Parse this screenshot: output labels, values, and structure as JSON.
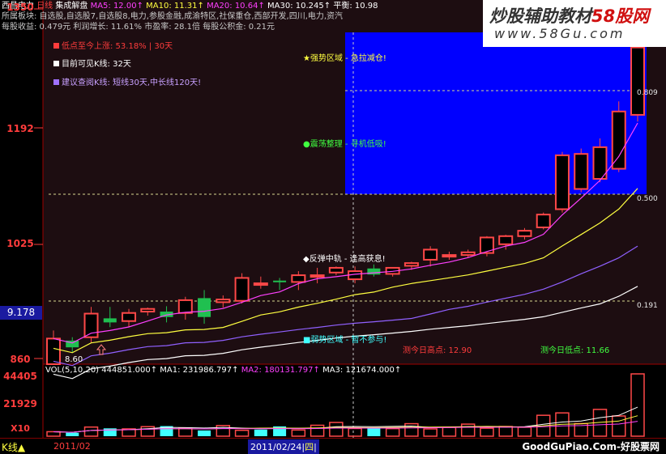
{
  "header": {
    "stock_name": "西昌电力",
    "period": "日线",
    "indicator": "集成解盘",
    "ma5_label": "MA5: 12.00↑",
    "ma10_label": "MA10: 11.31↑",
    "ma20_label": "MA20: 10.64↑",
    "ma30_label": "MA30: 10.245↑",
    "balance_label": "平衡: 10.98",
    "sector_line": "所属板块: 自选股,自选股7,自选股8,电力,参股金融,成渝特区,社保重仓,西部开发,四川,电力,资汽",
    "eps_line": "每股收益: 0.479元    利润增长: 11.61%    市盈率: 28.1倍    每股公积金: 0.21元"
  },
  "left_notes": {
    "rise_since_low": "低点至今上涨: 53.18% | 30天",
    "visible_k": "目前可见K线: 32天",
    "suggest": "建议查阅K线: 短线30天,中长线120天!"
  },
  "zones": {
    "strong": "★强势区域 - 急拉减仓!",
    "consolidate": "●震荡整理 - 寻机低吸!",
    "rebound": "◆反弹中轨 - 逢高获息!",
    "weak": "■弱势区域 - 暂不参与!"
  },
  "predict": {
    "high_label": "测今日高点: 12.90",
    "low_label": "测今日低点: 11.66"
  },
  "fib_levels": [
    "0.809",
    "0.500",
    "0.191"
  ],
  "yaxis": {
    "top": "1350",
    "mid1": "1192",
    "mid2": "1025",
    "current": "9.178",
    "low": "860"
  },
  "low_marker": "8.60",
  "vol_axis": {
    "top": "44405",
    "mid": "21929",
    "unit": "X10"
  },
  "volume_header": {
    "title": "VOL(5,10,20)",
    "value": "444851.000↑",
    "ma1": "MA1: 231986.797↑",
    "ma2": "MA2: 180131.797↑",
    "ma3": "MA3: 121674.000↑"
  },
  "bottom": {
    "mode": "K线",
    "month": "2011/02",
    "cursor_date": "2011/02/24",
    "weekday": "四",
    "site": "GoodGuPiao.Com-好股票网"
  },
  "watermark": {
    "title": "炒股辅助教材",
    "site_number": "58股网",
    "url": "www.58Gu.com"
  },
  "colors": {
    "up": "#ff4848",
    "down": "#20c050",
    "ma5": "#ffffff",
    "ma10": "#ffff40",
    "ma20": "#ff40ff",
    "ma30": "#00ff00",
    "strong_zone": "#0000ff",
    "label_red": "#ff3c3c"
  },
  "chart_data": {
    "type": "candlestick",
    "price_range": [
      8.6,
      13.5
    ],
    "candles": [
      {
        "o": 8.6,
        "h": 9.1,
        "l": 8.6,
        "c": 8.98
      },
      {
        "o": 8.95,
        "h": 9.0,
        "l": 8.78,
        "c": 8.85
      },
      {
        "o": 9.0,
        "h": 9.45,
        "l": 8.92,
        "c": 9.35
      },
      {
        "o": 9.28,
        "h": 9.45,
        "l": 9.15,
        "c": 9.22
      },
      {
        "o": 9.24,
        "h": 9.42,
        "l": 9.15,
        "c": 9.36
      },
      {
        "o": 9.38,
        "h": 9.44,
        "l": 9.32,
        "c": 9.42
      },
      {
        "o": 9.38,
        "h": 9.46,
        "l": 9.22,
        "c": 9.3
      },
      {
        "o": 9.36,
        "h": 9.6,
        "l": 9.26,
        "c": 9.55
      },
      {
        "o": 9.58,
        "h": 9.7,
        "l": 9.2,
        "c": 9.3
      },
      {
        "o": 9.52,
        "h": 9.62,
        "l": 9.44,
        "c": 9.56
      },
      {
        "o": 9.54,
        "h": 9.95,
        "l": 9.5,
        "c": 9.88
      },
      {
        "o": 9.8,
        "h": 9.9,
        "l": 9.72,
        "c": 9.8
      },
      {
        "o": 9.84,
        "h": 9.88,
        "l": 9.7,
        "c": 9.82
      },
      {
        "o": 9.82,
        "h": 9.98,
        "l": 9.7,
        "c": 9.92
      },
      {
        "o": 9.9,
        "h": 10.03,
        "l": 9.8,
        "c": 9.92
      },
      {
        "o": 9.96,
        "h": 10.05,
        "l": 9.92,
        "c": 10.03
      },
      {
        "o": 9.86,
        "h": 10.05,
        "l": 9.8,
        "c": 9.98
      },
      {
        "o": 10.02,
        "h": 10.08,
        "l": 9.9,
        "c": 9.93
      },
      {
        "o": 9.94,
        "h": 10.03,
        "l": 9.9,
        "c": 10.03
      },
      {
        "o": 10.06,
        "h": 10.12,
        "l": 10.0,
        "c": 10.1
      },
      {
        "o": 10.15,
        "h": 10.35,
        "l": 10.05,
        "c": 10.3
      },
      {
        "o": 10.2,
        "h": 10.27,
        "l": 10.15,
        "c": 10.22
      },
      {
        "o": 10.22,
        "h": 10.3,
        "l": 10.18,
        "c": 10.26
      },
      {
        "o": 10.25,
        "h": 10.5,
        "l": 10.2,
        "c": 10.48
      },
      {
        "o": 10.38,
        "h": 10.52,
        "l": 10.3,
        "c": 10.5
      },
      {
        "o": 10.5,
        "h": 10.62,
        "l": 10.45,
        "c": 10.58
      },
      {
        "o": 10.63,
        "h": 10.85,
        "l": 10.6,
        "c": 10.82
      },
      {
        "o": 10.9,
        "h": 11.75,
        "l": 10.85,
        "c": 11.7
      },
      {
        "o": 11.2,
        "h": 11.8,
        "l": 11.15,
        "c": 11.72
      },
      {
        "o": 11.35,
        "h": 11.95,
        "l": 11.3,
        "c": 11.82
      },
      {
        "o": 11.5,
        "h": 12.5,
        "l": 11.45,
        "c": 12.35
      },
      {
        "o": 12.3,
        "h": 13.5,
        "l": 12.2,
        "c": 13.3
      }
    ],
    "volume": {
      "axis_max": 44405,
      "units": "x10",
      "values": [
        3200,
        2500,
        6500,
        5600,
        5200,
        6800,
        7200,
        5800,
        4100,
        7600,
        4200,
        4700,
        7000,
        4400,
        7800,
        9800,
        5500,
        6300,
        5400,
        8900,
        5200,
        6300,
        8600,
        5700,
        6900,
        6400,
        14900,
        16600,
        9000,
        19100,
        14400,
        44485
      ],
      "up": [
        true,
        false,
        true,
        false,
        true,
        true,
        false,
        true,
        false,
        true,
        true,
        false,
        false,
        true,
        true,
        true,
        true,
        false,
        true,
        true,
        true,
        true,
        true,
        true,
        true,
        true,
        true,
        true,
        true,
        true,
        true,
        true
      ]
    }
  }
}
